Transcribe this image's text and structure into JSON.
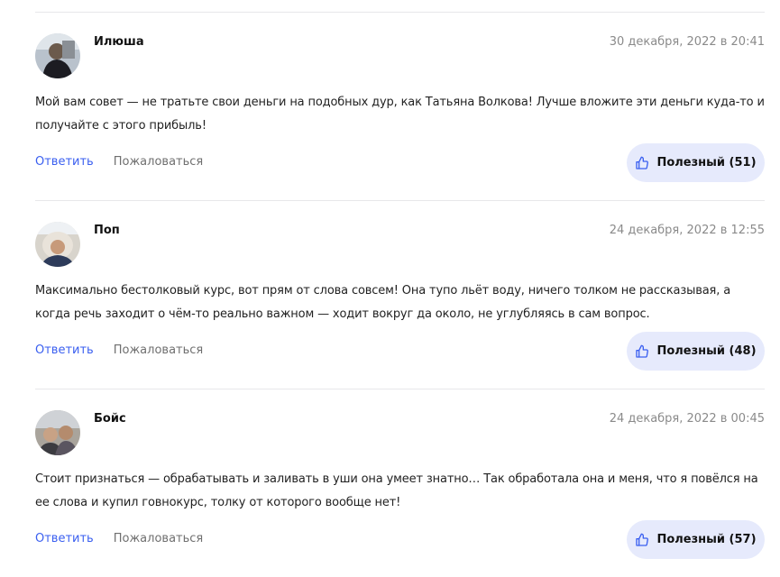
{
  "comments": [
    {
      "author": "Илюша",
      "date": "30 декабря, 2022 в 20:41",
      "text": "Мой вам совет — не тратьте свои деньги на подобных дур, как Татьяна Волкова! Лучше вложите эти деньги куда-то и получайте с этого прибыль!",
      "reply_label": "Ответить",
      "report_label": "Пожаловаться",
      "useful_label": "Полезный (51)"
    },
    {
      "author": "Поп",
      "date": "24 декабря, 2022 в 12:55",
      "text": "Максимально бестолковый курс, вот прям от слова совсем! Она тупо льёт воду, ничего толком не рассказывая, а когда речь заходит о чём-то реально важном — ходит вокруг да около, не углубляясь в сам вопрос.",
      "reply_label": "Ответить",
      "report_label": "Пожаловаться",
      "useful_label": "Полезный (48)"
    },
    {
      "author": "Бойс",
      "date": "24 декабря, 2022 в 00:45",
      "text": "Стоит признаться — обрабатывать и заливать в уши она умеет знатно… Так обработала она и меня, что я повёлся на ее слова и купил говнокурс, толку от которого вообще нет!",
      "reply_label": "Ответить",
      "report_label": "Пожаловаться",
      "useful_label": "Полезный (57)"
    }
  ],
  "icons": {
    "useful": "thumbs-up-icon"
  },
  "colors": {
    "link": "#3a5ff0",
    "useful_bg": "#e6eafc",
    "date": "#8a8a8a"
  }
}
